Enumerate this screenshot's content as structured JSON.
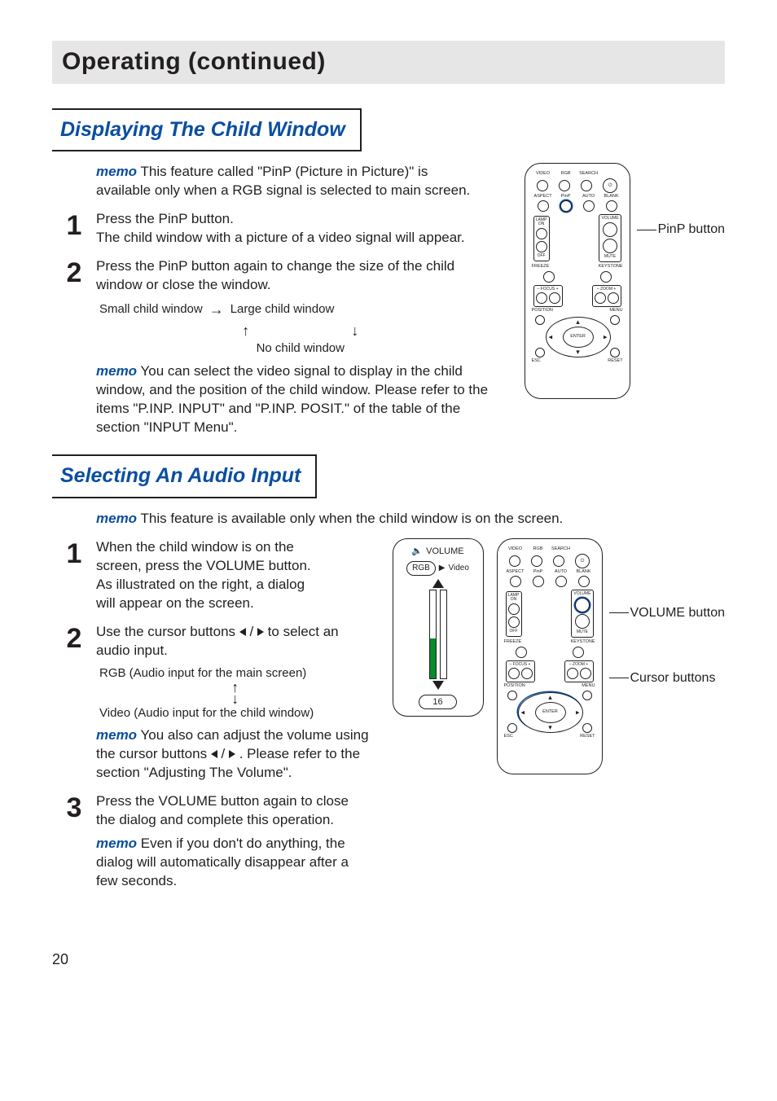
{
  "header": {
    "title": "Operating (continued)"
  },
  "section1": {
    "heading": "Displaying The Child Window",
    "intro_memo_label": "memo",
    "intro_text": " This feature called \"PinP (Picture in Picture)\" is available only when a RGB signal is selected to main screen.",
    "step1_num": "1",
    "step1_line1": "Press the PinP button.",
    "step1_line2": "The child window with a picture of a video signal will appear.",
    "step2_num": "2",
    "step2_text": "Press the PinP button again to change the size of the child window or close the window.",
    "cycle": {
      "small": "Small child window",
      "large": "Large child window",
      "none": "No child window"
    },
    "memo2_label": "memo",
    "memo2_text": " You can select the video signal to display in the child window, and the position of the child window. Please refer to the items \"P.INP. INPUT\" and \"P.INP. POSIT.\" of the table of the section \"INPUT Menu\".",
    "callout1": "PinP button"
  },
  "section2": {
    "heading": "Selecting An Audio Input",
    "intro_memo_label": "memo",
    "intro_text": " This feature is available only when the child window is on the screen.",
    "step1_num": "1",
    "step1_text": "When the child window is on the screen, press the VOLUME button. As illustrated on the right, a dialog will appear on the screen.",
    "step2_num": "2",
    "step2_pre": "Use the cursor buttons ",
    "step2_post": " to select an audio input.",
    "audio_main": "RGB (Audio input for the main screen)",
    "audio_child": "Video (Audio input for the child window)",
    "memo2_label": "memo",
    "memo2_pre": " You also can adjust the volume using the cursor buttons ",
    "memo2_post": " . Please refer to the section \"Adjusting The Volume\".",
    "step3_num": "3",
    "step3_text": "Press the VOLUME button again to close the dialog and complete this operation.",
    "memo3_label": "memo",
    "memo3_text": " Even if you don't do anything, the dialog will automatically disappear after a few seconds.",
    "callout_volume": "VOLUME button",
    "callout_cursor": "Cursor buttons"
  },
  "volume_dialog": {
    "title": "VOLUME",
    "rgb": "RGB",
    "video": "Video",
    "value": "16"
  },
  "remote": {
    "row1": [
      "VIDEO",
      "RGB",
      "SEARCH",
      ""
    ],
    "row2": [
      "ASPECT",
      "PinP",
      "AUTO",
      "BLANK"
    ],
    "lamp_label": "LAMP",
    "volume_label": "VOLUME",
    "on": "ON",
    "off": "OFF",
    "mute": "MUTE",
    "freeze": "FREEZE",
    "keystone": "KEYSTONE",
    "focus": "FOCUS",
    "zoom": "ZOOM",
    "position": "POSITION",
    "menu": "MENU",
    "enter": "ENTER",
    "esc": "ESC",
    "reset": "RESET"
  },
  "page_number": "20"
}
